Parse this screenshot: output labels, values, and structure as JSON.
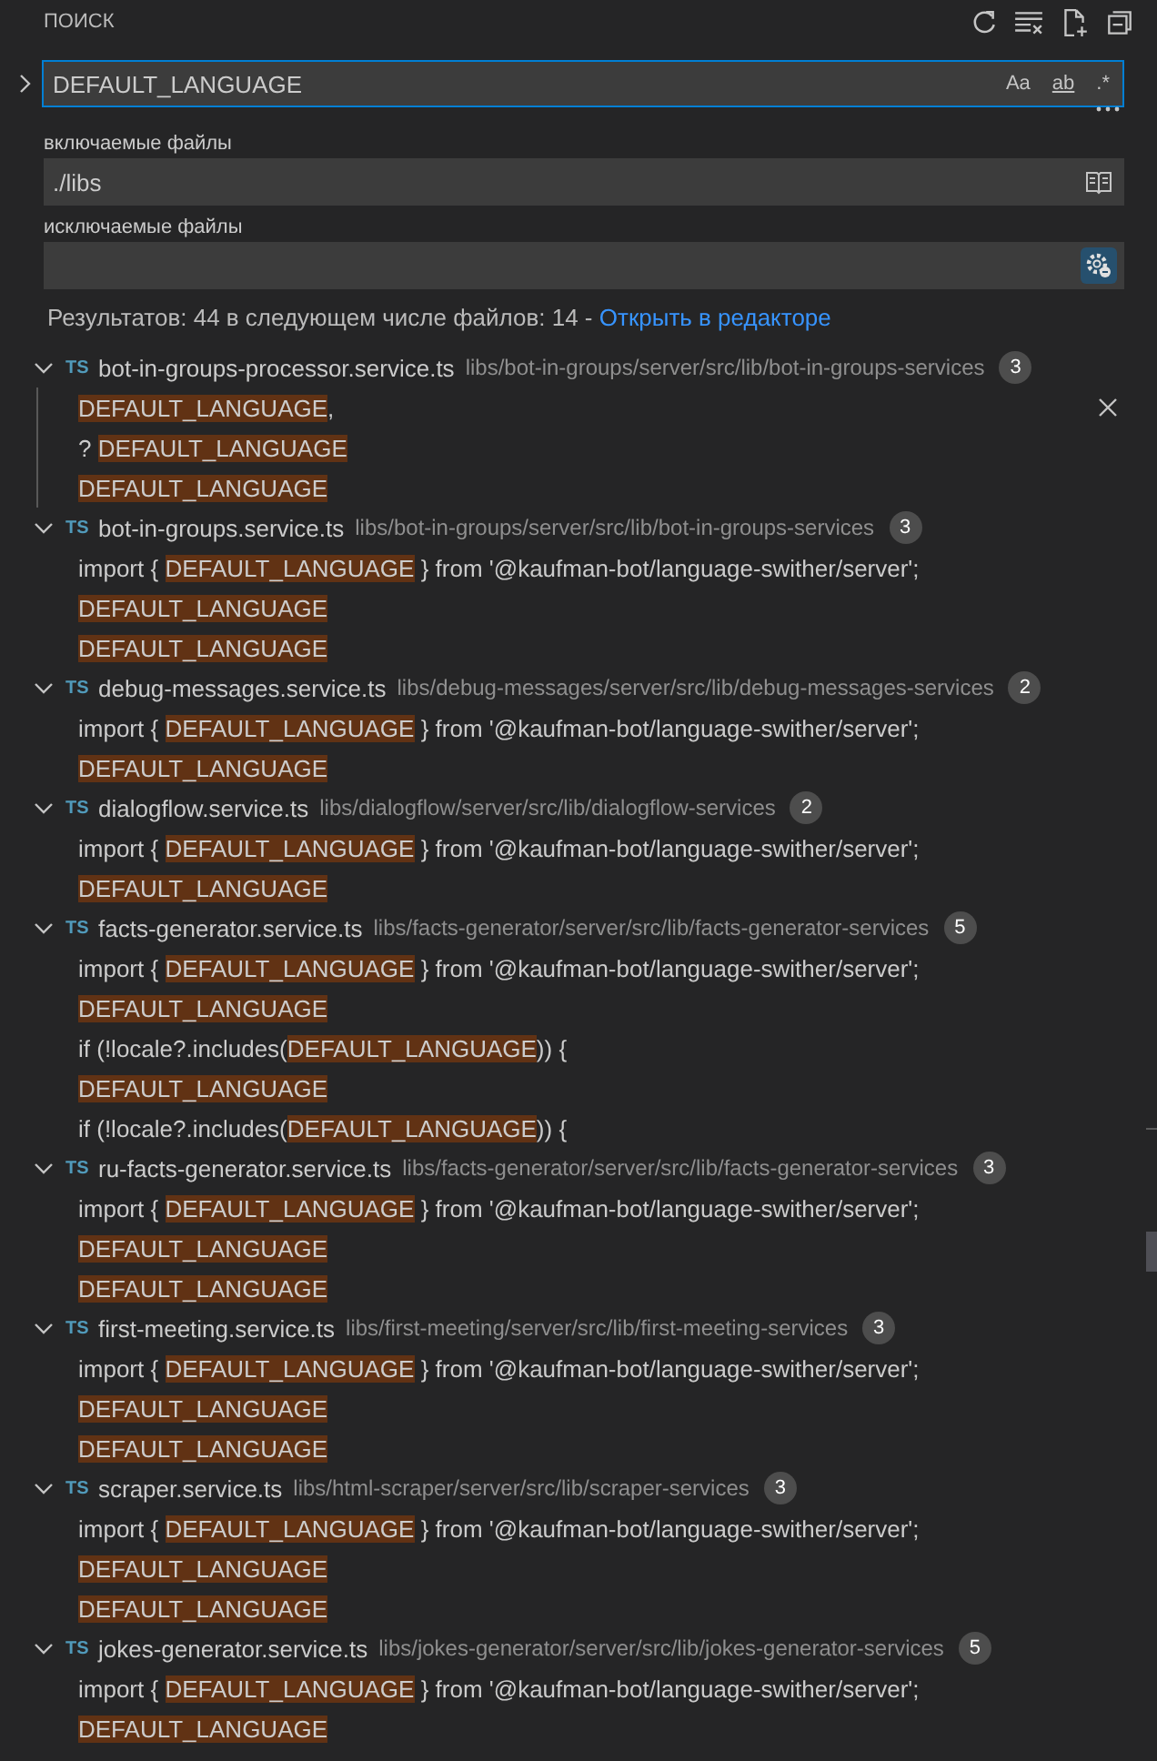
{
  "header": {
    "title": "ПОИСК"
  },
  "search": {
    "value": "DEFAULT_LANGUAGE",
    "replace_expanded": false,
    "options": [
      {
        "label": "Aa",
        "kind": "case",
        "on": false
      },
      {
        "label": "ab",
        "kind": "word",
        "on": false
      },
      {
        "label": ".*",
        "kind": "regex",
        "on": false
      }
    ]
  },
  "include": {
    "label": "включаемые файлы",
    "value": "./libs",
    "open_editors_only": false
  },
  "exclude": {
    "label": "исключаемые файлы",
    "use_exclude_settings": true
  },
  "summary": {
    "text": "Результатов: 44 в следующем числе файлов: 14 - ",
    "link": "Открыть в редакторе"
  },
  "results": [
    {
      "icon": "TS",
      "file": "bot-in-groups-processor.service.ts",
      "path": "libs/bot-in-groups/server/src/lib/bot-in-groups-services",
      "count": "3",
      "expanded": true,
      "focused": true,
      "matches": [
        {
          "match": "DEFAULT_LANGUAGE",
          "after": ",",
          "dismiss": true
        },
        {
          "before": "? ",
          "match": "DEFAULT_LANGUAGE",
          "dismiss": false
        },
        {
          "match": "DEFAULT_LANGUAGE",
          "dismiss": false
        }
      ]
    },
    {
      "icon": "TS",
      "file": "bot-in-groups.service.ts",
      "path": "libs/bot-in-groups/server/src/lib/bot-in-groups-services",
      "count": "3",
      "expanded": true,
      "focused": false,
      "matches": [
        {
          "before": "import { ",
          "match": "DEFAULT_LANGUAGE",
          "after": " } from '@kaufman-bot/language-swither/server';",
          "dismiss": false
        },
        {
          "match": "DEFAULT_LANGUAGE",
          "dismiss": false
        },
        {
          "match": "DEFAULT_LANGUAGE",
          "dismiss": false
        }
      ]
    },
    {
      "icon": "TS",
      "file": "debug-messages.service.ts",
      "path": "libs/debug-messages/server/src/lib/debug-messages-services",
      "count": "2",
      "expanded": true,
      "focused": false,
      "matches": [
        {
          "before": "import { ",
          "match": "DEFAULT_LANGUAGE",
          "after": " } from '@kaufman-bot/language-swither/server';",
          "dismiss": false
        },
        {
          "match": "DEFAULT_LANGUAGE",
          "dismiss": false
        }
      ]
    },
    {
      "icon": "TS",
      "file": "dialogflow.service.ts",
      "path": "libs/dialogflow/server/src/lib/dialogflow-services",
      "count": "2",
      "expanded": true,
      "focused": false,
      "matches": [
        {
          "before": "import { ",
          "match": "DEFAULT_LANGUAGE",
          "after": " } from '@kaufman-bot/language-swither/server';",
          "dismiss": false
        },
        {
          "match": "DEFAULT_LANGUAGE",
          "dismiss": false
        }
      ]
    },
    {
      "icon": "TS",
      "file": "facts-generator.service.ts",
      "path": "libs/facts-generator/server/src/lib/facts-generator-services",
      "count": "5",
      "expanded": true,
      "focused": false,
      "matches": [
        {
          "before": "import { ",
          "match": "DEFAULT_LANGUAGE",
          "after": " } from '@kaufman-bot/language-swither/server';",
          "dismiss": false
        },
        {
          "match": "DEFAULT_LANGUAGE",
          "dismiss": false
        },
        {
          "before": "if (!locale?.includes(",
          "match": "DEFAULT_LANGUAGE",
          "after": ")) {",
          "dismiss": false
        },
        {
          "match": "DEFAULT_LANGUAGE",
          "dismiss": false
        },
        {
          "before": "if (!locale?.includes(",
          "match": "DEFAULT_LANGUAGE",
          "after": ")) {",
          "dismiss": false
        }
      ]
    },
    {
      "icon": "TS",
      "file": "ru-facts-generator.service.ts",
      "path": "libs/facts-generator/server/src/lib/facts-generator-services",
      "count": "3",
      "expanded": true,
      "focused": false,
      "matches": [
        {
          "before": "import { ",
          "match": "DEFAULT_LANGUAGE",
          "after": " } from '@kaufman-bot/language-swither/server';",
          "dismiss": false
        },
        {
          "match": "DEFAULT_LANGUAGE",
          "dismiss": false
        },
        {
          "match": "DEFAULT_LANGUAGE",
          "dismiss": false
        }
      ]
    },
    {
      "icon": "TS",
      "file": "first-meeting.service.ts",
      "path": "libs/first-meeting/server/src/lib/first-meeting-services",
      "count": "3",
      "expanded": true,
      "focused": false,
      "matches": [
        {
          "before": "import { ",
          "match": "DEFAULT_LANGUAGE",
          "after": " } from '@kaufman-bot/language-swither/server';",
          "dismiss": false
        },
        {
          "match": "DEFAULT_LANGUAGE",
          "dismiss": false
        },
        {
          "match": "DEFAULT_LANGUAGE",
          "dismiss": false
        }
      ]
    },
    {
      "icon": "TS",
      "file": "scraper.service.ts",
      "path": "libs/html-scraper/server/src/lib/scraper-services",
      "count": "3",
      "expanded": true,
      "focused": false,
      "matches": [
        {
          "before": "import { ",
          "match": "DEFAULT_LANGUAGE",
          "after": " } from '@kaufman-bot/language-swither/server';",
          "dismiss": false
        },
        {
          "match": "DEFAULT_LANGUAGE",
          "dismiss": false
        },
        {
          "match": "DEFAULT_LANGUAGE",
          "dismiss": false
        }
      ]
    },
    {
      "icon": "TS",
      "file": "jokes-generator.service.ts",
      "path": "libs/jokes-generator/server/src/lib/jokes-generator-services",
      "count": "5",
      "expanded": true,
      "focused": false,
      "matches": [
        {
          "before": "import { ",
          "match": "DEFAULT_LANGUAGE",
          "after": " } from '@kaufman-bot/language-swither/server';",
          "dismiss": false
        },
        {
          "match": "DEFAULT_LANGUAGE",
          "dismiss": false
        }
      ]
    }
  ]
}
